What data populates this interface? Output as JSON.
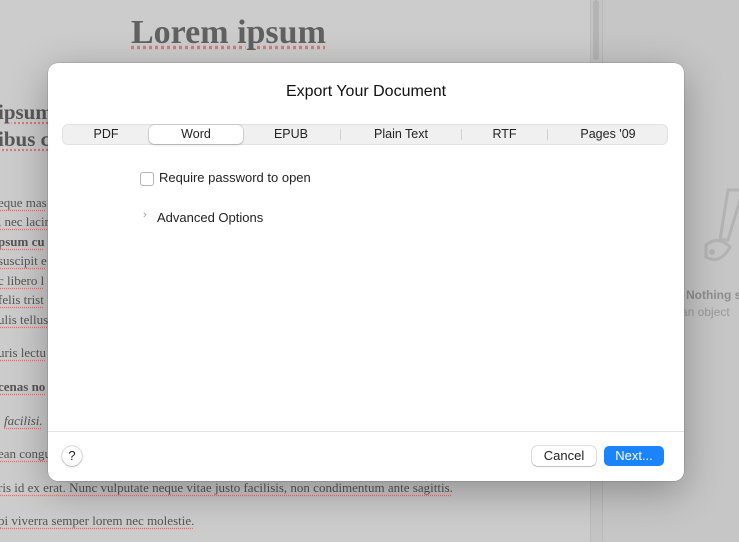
{
  "document": {
    "heading": "Lorem ipsum",
    "fragments": [
      "ipsum",
      "ibus c",
      "eque mas",
      ", nec lacin",
      "psum cu",
      "suscipit e",
      "c libero l",
      "felis trist",
      "ulis tellus",
      "uris lectu",
      "cenas no",
      "facilisi.",
      "ean congu",
      "ris id ex erat. Nunc vulputate neque vitae justo facilisis, non condimentum ante sagittis.",
      "pi viverra semper lorem nec molestie."
    ]
  },
  "sidebar": {
    "empty_title": "Nothing s",
    "empty_subtitle": "an object"
  },
  "dialog": {
    "title": "Export Your Document",
    "tabs": [
      {
        "label": "PDF",
        "selected": false
      },
      {
        "label": "Word",
        "selected": true
      },
      {
        "label": "EPUB",
        "selected": false
      },
      {
        "label": "Plain Text",
        "selected": false
      },
      {
        "label": "RTF",
        "selected": false
      },
      {
        "label": "Pages '09",
        "selected": false
      }
    ],
    "password_checkbox": {
      "label": "Require password to open",
      "checked": false
    },
    "advanced_options": {
      "label": "Advanced Options",
      "expanded": false
    },
    "help_label": "?",
    "cancel_label": "Cancel",
    "next_label": "Next...",
    "accent_color": "#1a84ff"
  }
}
